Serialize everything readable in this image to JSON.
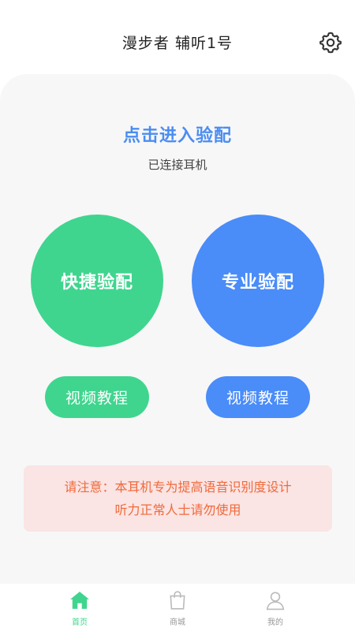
{
  "header": {
    "title": "漫步者 辅听1号",
    "settings_icon": "gear-icon"
  },
  "main": {
    "enter_fitting": "点击进入验配",
    "status": "已连接耳机",
    "quick_fitting": "快捷验配",
    "pro_fitting": "专业验配",
    "video_tutorial_left": "视频教程",
    "video_tutorial_right": "视频教程",
    "notice_line1": "请注意：本耳机专为提高语音识别度设计",
    "notice_line2": "听力正常人士请勿使用"
  },
  "tabbar": {
    "items": [
      {
        "label": "首页",
        "icon": "home-icon",
        "active": true
      },
      {
        "label": "商城",
        "icon": "shopping-bag-icon",
        "active": false
      },
      {
        "label": "我的",
        "icon": "user-icon",
        "active": false
      }
    ]
  },
  "colors": {
    "green": "#3fd58e",
    "blue": "#4a8cf8",
    "title_blue": "#4a8df2",
    "notice_bg": "#fae4e4",
    "notice_text": "#f06a3a"
  }
}
